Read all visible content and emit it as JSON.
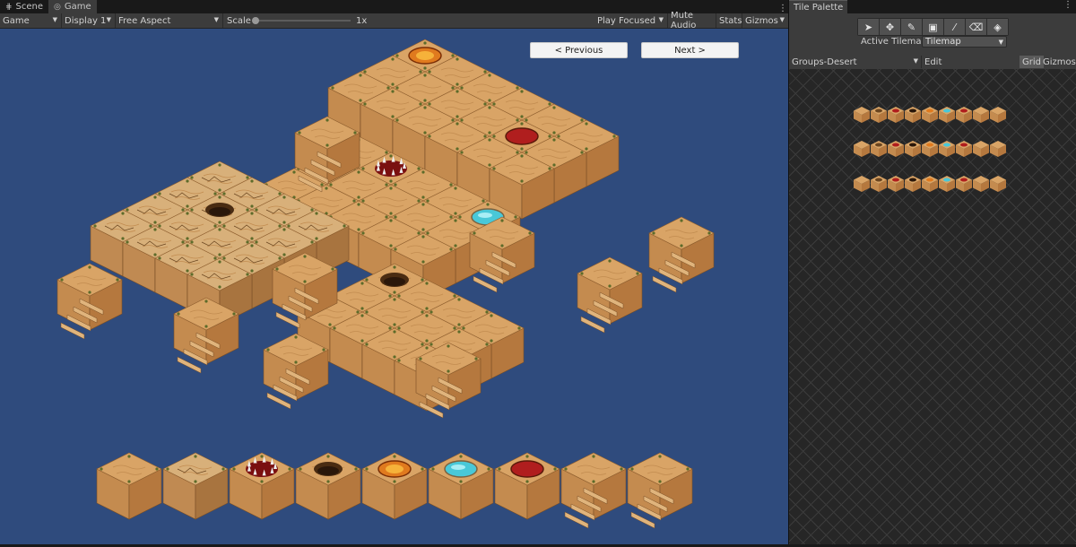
{
  "left_tabs": [
    {
      "label": "Scene",
      "icon": "grid-icon"
    },
    {
      "label": "Game",
      "icon": "gamepad-icon"
    }
  ],
  "toolbar": {
    "view": "Game",
    "display": "Display 1",
    "aspect": "Free Aspect",
    "scale_label": "Scale",
    "scale_value": "1x",
    "play_mode": "Play Focused",
    "mute": "Mute Audio",
    "stats": "Stats",
    "gizmos": "Gizmos"
  },
  "game": {
    "prev_label": "< Previous",
    "next_label": "Next >"
  },
  "palette": {
    "tab": "Tile Palette",
    "tools": [
      "select-tool-icon",
      "move-tool-icon",
      "paint-tool-icon",
      "box-fill-tool-icon",
      "picker-tool-icon",
      "eraser-tool-icon",
      "fill-tool-icon"
    ],
    "active_tilemap_label": "Active Tilemap",
    "active_tilemap_value": "Tilemap",
    "palette_name": "Groups-Desert",
    "edit": "Edit",
    "grid": "Grid",
    "gizmos": "Gizmos"
  },
  "colors": {
    "sand": "#d9a466",
    "sand_dark": "#b5783e",
    "sand_side": "#c48b4f",
    "sky": "#2f4b7d",
    "lava": "#e07a1e",
    "water": "#49c8d8",
    "blood": "#b01e1e"
  }
}
